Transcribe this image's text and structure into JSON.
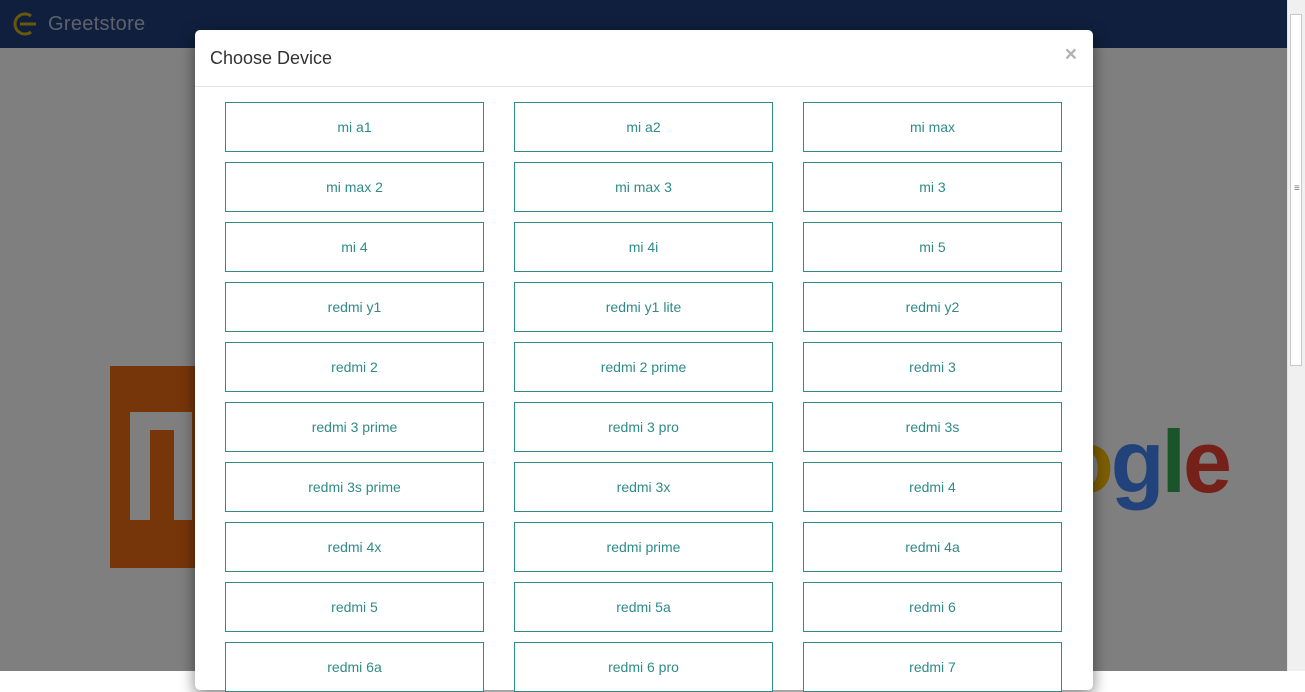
{
  "brand": {
    "name": "Greetstore"
  },
  "modal": {
    "title": "Choose Device",
    "close_label": "×",
    "devices": [
      "mi a1",
      "mi a2",
      "mi max",
      "mi max 2",
      "mi max 3",
      "mi 3",
      "mi 4",
      "mi 4i",
      "mi 5",
      "redmi y1",
      "redmi y1 lite",
      "redmi y2",
      "redmi 2",
      "redmi 2 prime",
      "redmi 3",
      "redmi 3 prime",
      "redmi 3 pro",
      "redmi 3s",
      "redmi 3s prime",
      "redmi 3x",
      "redmi 4",
      "redmi 4x",
      "redmi prime",
      "redmi 4a",
      "redmi 5",
      "redmi 5a",
      "redmi 6",
      "redmi 6a",
      "redmi 6 pro",
      "redmi 7"
    ]
  },
  "background": {
    "google_letters": [
      "o",
      "g",
      "l",
      "e"
    ]
  },
  "colors": {
    "navbar": "#1f3f7a",
    "accent": "#2e8b88",
    "mi_orange": "#ef6c12"
  }
}
